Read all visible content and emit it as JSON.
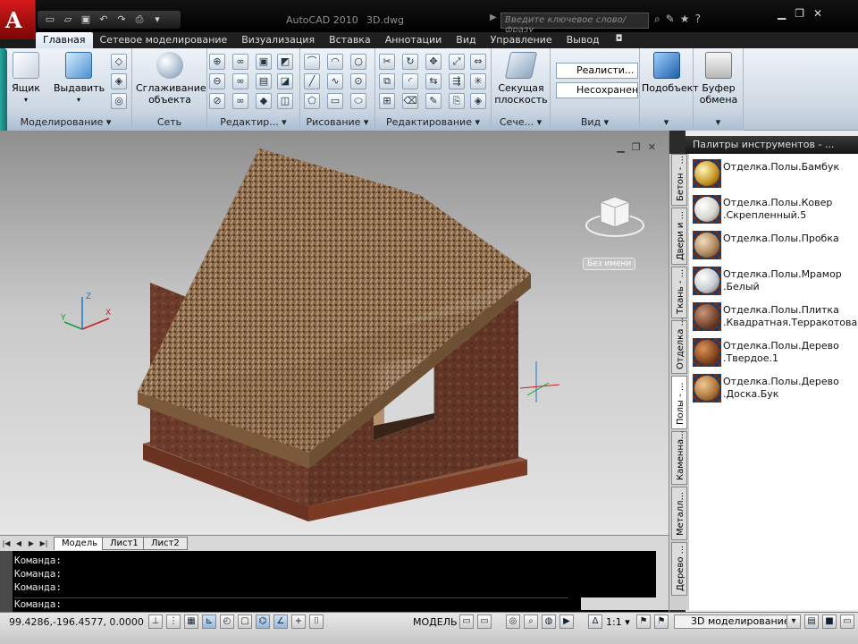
{
  "titlebar": {
    "app_title": "AutoCAD 2010",
    "doc_title": "3D.dwg",
    "search_placeholder": "Введите ключевое слово/фразу",
    "logo_letter": "A"
  },
  "tabs": [
    {
      "label": "Главная"
    },
    {
      "label": "Сетевое моделирование"
    },
    {
      "label": "Визуализация"
    },
    {
      "label": "Вставка"
    },
    {
      "label": "Аннотации"
    },
    {
      "label": "Вид"
    },
    {
      "label": "Управление"
    },
    {
      "label": "Вывод"
    }
  ],
  "ribbon": {
    "box_label": "Ящик",
    "extrude_label": "Выдавить",
    "smooth_label_1": "Сглаживание",
    "smooth_label_2": "объекта",
    "section_label_1": "Секущая",
    "section_label_2": "плоскость",
    "style_select": "Реалисти...",
    "unsaved_select": "Несохранен...",
    "similar_label": "Подобъект",
    "clipboard_label_1": "Буфер",
    "clipboard_label_2": "обмена",
    "panels": {
      "modeling": "Моделирование ▾",
      "mesh": "Сеть",
      "edit": "Редактир... ▾",
      "draw": "Рисование ▾",
      "modify": "Редактирование ▾",
      "section": "Сече... ▾",
      "view": "Вид ▾"
    }
  },
  "viewport": {
    "wcs_label": "Без имени"
  },
  "layout_tabs": [
    "Модель",
    "Лист1",
    "Лист2"
  ],
  "command_lines": [
    "Команда:",
    "Команда:",
    "Команда:",
    "Команда:"
  ],
  "palette": {
    "title": "Палитры инструментов - ...",
    "side_tabs": [
      "Бетон - ...",
      "Двери и ...",
      "Ткань - ...",
      "Отделка ...",
      "Полы - ...",
      "Каменна...",
      "Металл...",
      "Дерево ..."
    ],
    "items": [
      {
        "line1": "Отделка.Полы.Бамбук",
        "line2": "",
        "color": "#c99a2a"
      },
      {
        "line1": "Отделка.Полы.Ковер",
        "line2": ".Скрепленный.5",
        "color": "#d8d8d0"
      },
      {
        "line1": "Отделка.Полы.Пробка",
        "line2": "",
        "color": "#b08a5e"
      },
      {
        "line1": "Отделка.Полы.Мрамор",
        "line2": ".Белый",
        "color": "#c8ccd2"
      },
      {
        "line1": "Отделка.Полы.Плитка",
        "line2": ".Квадратная.Терракотовая",
        "color": "#7a4a30"
      },
      {
        "line1": "Отделка.Полы.Дерево",
        "line2": ".Твердое.1",
        "color": "#8a4a22"
      },
      {
        "line1": "Отделка.Полы.Дерево",
        "line2": ".Доска.Бук",
        "color": "#b07a40"
      }
    ]
  },
  "status": {
    "coords": "99.4286,-196.4577, 0.0000",
    "model": "МОДЕЛЬ",
    "scale": "1:1 ▾",
    "workspace": "3D моделирование"
  },
  "colors": {
    "roof": "#8a6a4a",
    "wall": "#6a3a2a",
    "base": "#6a3220",
    "accent": "#dbe6f1"
  }
}
